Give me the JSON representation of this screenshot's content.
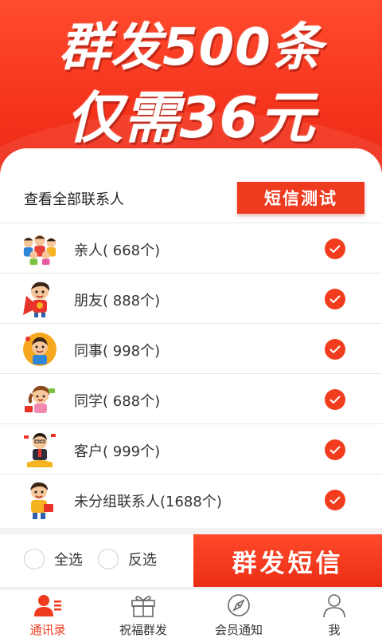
{
  "banner": {
    "line1": "群发500条",
    "line2": "仅需36元"
  },
  "header": {
    "view_all_label": "查看全部联系人",
    "sms_test_label": "短信测试"
  },
  "groups": [
    {
      "label": "亲人( 668个)",
      "avatar_icon": "family-avatar-icon",
      "checked": true
    },
    {
      "label": "朋友( 888个)",
      "avatar_icon": "friend-avatar-icon",
      "checked": true
    },
    {
      "label": "同事( 998个)",
      "avatar_icon": "colleague-avatar-icon",
      "checked": true
    },
    {
      "label": "同学( 688个)",
      "avatar_icon": "classmate-avatar-icon",
      "checked": true
    },
    {
      "label": "客户( 999个)",
      "avatar_icon": "customer-avatar-icon",
      "checked": true
    },
    {
      "label": "未分组联系人(1688个)",
      "avatar_icon": "ungrouped-avatar-icon",
      "checked": true
    }
  ],
  "actions": {
    "select_all_label": "全选",
    "invert_label": "反选",
    "send_label": "群发短信"
  },
  "tabs": [
    {
      "label": "通讯录",
      "icon": "contacts-icon",
      "active": true
    },
    {
      "label": "祝福群发",
      "icon": "gift-icon",
      "active": false
    },
    {
      "label": "会员通知",
      "icon": "compass-icon",
      "active": false
    },
    {
      "label": "我",
      "icon": "person-icon",
      "active": false
    }
  ],
  "colors": {
    "accent": "#f03a1c",
    "banner": "#f4321c"
  }
}
